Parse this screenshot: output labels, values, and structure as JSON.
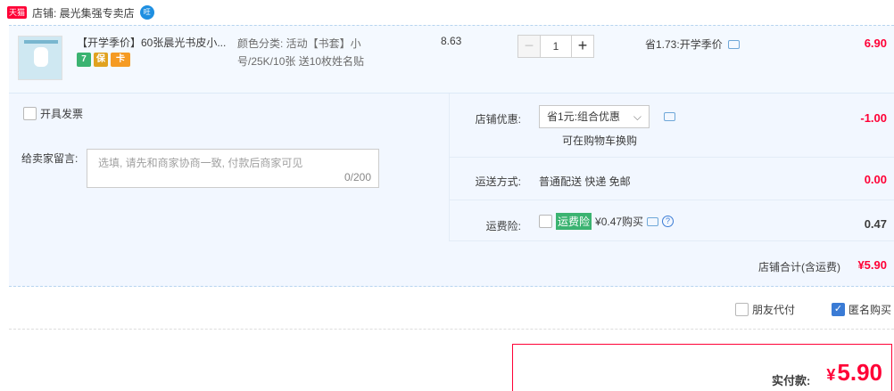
{
  "shop": {
    "badge": "天猫",
    "label": "店铺: 晨光集强专卖店",
    "wangwang": "旺"
  },
  "item": {
    "title": "【开学季价】60张晨光书皮小...",
    "services": [
      "7",
      "保",
      "卡"
    ],
    "sku": "颜色分类: 活动【书套】小号/25K/10张 送10枚姓名贴",
    "unit_price": "8.63",
    "quantity": "1",
    "minus": "−",
    "plus": "+",
    "discount_note": "省1.73:开学季价",
    "total": "6.90"
  },
  "order": {
    "invoice_label": "开具发票",
    "message_label": "给卖家留言:",
    "message_placeholder": "选填, 请先和商家协商一致, 付款后商家可见",
    "message_count": "0/200",
    "shop_discount_label": "店铺优惠:",
    "shop_discount_selected": "省1元:组合优惠",
    "shop_discount_chevron": "⌵",
    "shop_discount_note": "可在购物车换购",
    "shop_discount_value": "-1.00",
    "shipping_label": "运送方式:",
    "shipping_text": "普通配送 快递 免邮",
    "shipping_value": "0.00",
    "insurance_label": "运费险:",
    "insurance_tag": "运费险",
    "insurance_text": "¥0.47购买",
    "insurance_help": "?",
    "insurance_value": "0.47",
    "shop_total_label": "店铺合计(含运费)",
    "shop_total_value": "¥5.90"
  },
  "options": {
    "friend_pay_label": "朋友代付",
    "anonymous_label": "匿名购买",
    "anonymous_check": "✓"
  },
  "payment": {
    "label": "实付款:",
    "currency": "¥",
    "amount": "5.90"
  },
  "colors": {
    "accent_red": "#ff0036",
    "row_bg": "#f4f9ff",
    "link_blue": "#3a7bd5"
  }
}
